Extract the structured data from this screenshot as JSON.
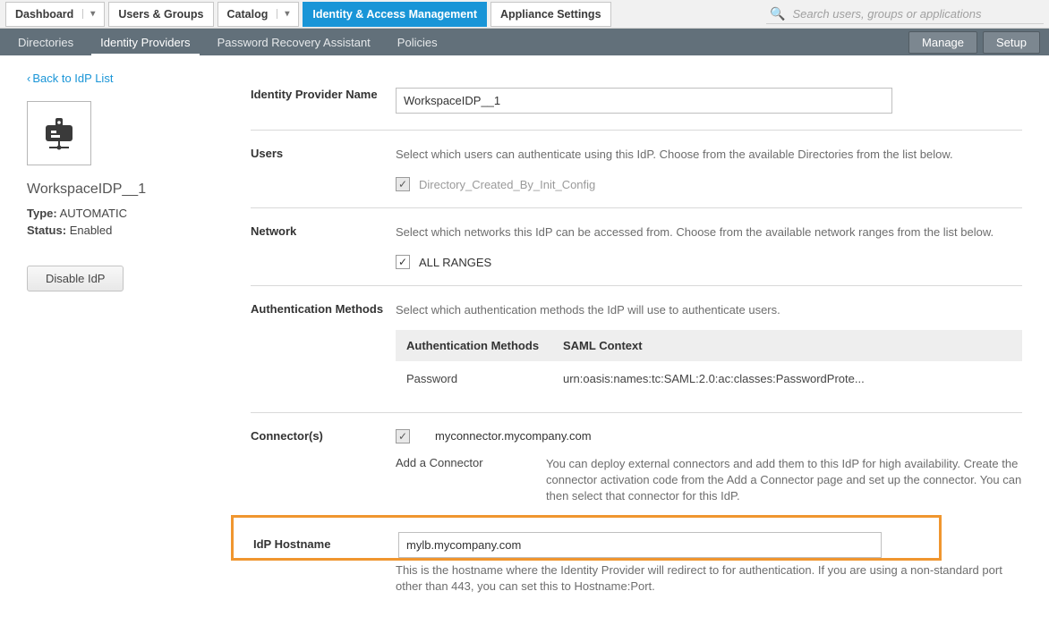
{
  "search": {
    "placeholder": "Search users, groups or applications"
  },
  "topTabs": {
    "dashboard": "Dashboard",
    "users": "Users & Groups",
    "catalog": "Catalog",
    "iam": "Identity & Access Management",
    "appliance": "Appliance Settings"
  },
  "subTabs": {
    "directories": "Directories",
    "idp": "Identity Providers",
    "pra": "Password Recovery Assistant",
    "policies": "Policies",
    "manage": "Manage",
    "setup": "Setup"
  },
  "side": {
    "back": "Back to IdP List",
    "name": "WorkspaceIDP__1",
    "typeLabel": "Type:",
    "typeValue": "AUTOMATIC",
    "statusLabel": "Status:",
    "statusValue": "Enabled",
    "disable": "Disable IdP"
  },
  "form": {
    "nameLabel": "Identity Provider Name",
    "nameValue": "WorkspaceIDP__1",
    "usersLabel": "Users",
    "usersHelp": "Select which users can authenticate using this IdP. Choose from the available Directories from the list below.",
    "usersOption": "Directory_Created_By_Init_Config",
    "networkLabel": "Network",
    "networkHelp": "Select which networks this IdP can be accessed from. Choose from the available network ranges from the list below.",
    "networkOption": "ALL RANGES",
    "authLabel": "Authentication Methods",
    "authHelp": "Select which authentication methods the IdP will use to authenticate users.",
    "authTable": {
      "col1": "Authentication Methods",
      "col2": "SAML Context",
      "row1c1": "Password",
      "row1c2": "urn:oasis:names:tc:SAML:2.0:ac:classes:PasswordProte..."
    },
    "connLabel": "Connector(s)",
    "connOption": "myconnector.mycompany.com",
    "connAddLabel": "Add a Connector",
    "connAddHelp": "You can deploy external connectors and add them to this IdP for high availability. Create the connector activation code from the Add a Connector page and set up the connector. You can then select that connector for this IdP.",
    "hostLabel": "IdP Hostname",
    "hostValue": "mylb.mycompany.com",
    "hostHelp": "This is the hostname where the Identity Provider will redirect to for authentication. If you are using a non-standard port other than 443, you can set this to Hostname:Port."
  }
}
